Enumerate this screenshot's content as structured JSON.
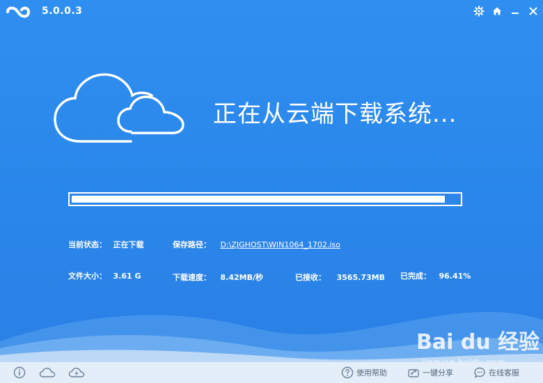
{
  "app": {
    "version": "5.0.0.3"
  },
  "window_controls": [
    {
      "name": "settings-button",
      "icon": "gear-icon"
    },
    {
      "name": "home-button",
      "icon": "home-icon"
    },
    {
      "name": "minimize-button",
      "icon": "minimize-icon"
    },
    {
      "name": "close-button",
      "icon": "close-icon"
    }
  ],
  "hero": {
    "headline": "正在从云端下载系统..."
  },
  "progress": {
    "percent": 96.41
  },
  "info": {
    "status_label": "当前状态：",
    "status_value": "正在下载",
    "path_label": "保存路径：",
    "path_value": "D:\\ZJGHOST\\WIN1064_1702.iso",
    "size_label": "文件大小：",
    "size_value": "3.61 G",
    "speed_label": "下载速度：",
    "speed_value": "8.42MB/秒",
    "received_label": "已接收：",
    "received_value": "3565.73MB",
    "done_label": "已完成：",
    "done_value": "96.41%"
  },
  "bottombar": {
    "help_label": "使用帮助",
    "share_label": "一键分享",
    "service_label": "在线客服"
  },
  "watermark": {
    "brand": "Bai du 经验",
    "url": "jingyan.baidu.com"
  },
  "colors": {
    "background": "#2a86ea",
    "bottombar": "#e3eef9",
    "text": "#ffffff"
  }
}
